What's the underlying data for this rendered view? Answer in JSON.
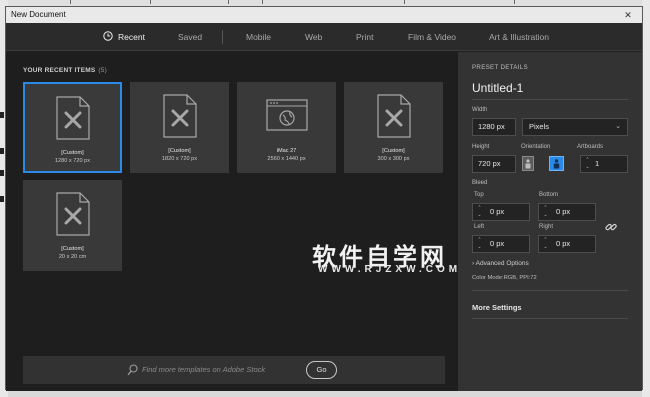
{
  "window": {
    "title": "New Document",
    "close_glyph": "✕"
  },
  "tabs": [
    {
      "label": "Recent",
      "active": true
    },
    {
      "label": "Saved",
      "active": false
    },
    {
      "label": "Mobile",
      "active": false
    },
    {
      "label": "Web",
      "active": false
    },
    {
      "label": "Print",
      "active": false
    },
    {
      "label": "Film & Video",
      "active": false
    },
    {
      "label": "Art & Illustration",
      "active": false
    }
  ],
  "recent": {
    "heading": "YOUR RECENT ITEMS",
    "count": "(5)",
    "items": [
      {
        "name": "[Custom]",
        "dims": "1280 x 720 px",
        "icon": "custom-document-icon",
        "selected": true
      },
      {
        "name": "[Custom]",
        "dims": "1820 x 720 px",
        "icon": "custom-document-icon",
        "selected": false
      },
      {
        "name": "iMac 27",
        "dims": "2560 x 1440 px",
        "icon": "web-browser-icon",
        "selected": false
      },
      {
        "name": "[Custom]",
        "dims": "300 x 300 px",
        "icon": "custom-document-icon",
        "selected": false
      },
      {
        "name": "[Custom]",
        "dims": "20 x 20 cm",
        "icon": "custom-document-icon",
        "selected": false
      }
    ]
  },
  "stock": {
    "placeholder": "Find more templates on Adobe Stock",
    "go_label": "Go"
  },
  "preset": {
    "header": "PRESET DETAILS",
    "doc_title": "Untitled-1",
    "width_label": "Width",
    "width_value": "1280 px",
    "unit_value": "Pixels",
    "height_label": "Height",
    "height_value": "720 px",
    "orientation_label": "Orientation",
    "artboards_label": "Artboards",
    "artboards_value": "1",
    "bleed_label": "Bleed",
    "top_label": "Top",
    "top_value": "0 px",
    "bottom_label": "Bottom",
    "bottom_value": "0 px",
    "left_label": "Left",
    "left_value": "0 px",
    "right_label": "Right",
    "right_value": "0 px",
    "advanced_label": "Advanced Options",
    "color_mode": "Color Mode:RGB, PPI:72",
    "more_settings": "More Settings"
  },
  "watermark": {
    "cn": "软件自学网",
    "en": "WWW.RJZXW.COM"
  },
  "colors": {
    "accent": "#2b8ae8",
    "panel": "#333333",
    "main": "#1e1e1e"
  }
}
